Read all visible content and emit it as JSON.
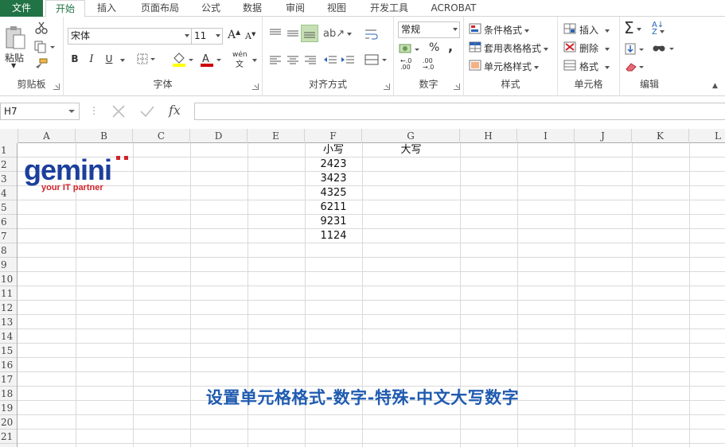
{
  "tabs": [
    "文件",
    "开始",
    "插入",
    "页面布局",
    "公式",
    "数据",
    "审阅",
    "视图",
    "开发工具",
    "ACROBAT"
  ],
  "ribbon": {
    "clipboard": {
      "paste_label": "粘贴",
      "group_label": "剪贴板"
    },
    "font": {
      "font_name": "宋体",
      "font_size": "11",
      "bold": "B",
      "italic": "I",
      "underline": "U",
      "phonetic": "wén",
      "phonetic_char": "文",
      "group_label": "字体"
    },
    "alignment": {
      "group_label": "对齐方式"
    },
    "number": {
      "format": "常规",
      "percent": "%",
      "comma": ",",
      "group_label": "数字"
    },
    "styles": {
      "conditional": "条件格式",
      "table": "套用表格格式",
      "cell_styles": "单元格样式",
      "group_label": "样式"
    },
    "cells": {
      "insert": "插入",
      "delete": "删除",
      "format": "格式",
      "group_label": "单元格"
    },
    "editing": {
      "group_label": "编辑"
    }
  },
  "formula_bar": {
    "name_box": "H7",
    "fx": "fx",
    "value": ""
  },
  "columns": [
    "A",
    "B",
    "C",
    "D",
    "E",
    "F",
    "G",
    "H",
    "I",
    "J",
    "K",
    "L"
  ],
  "rows": [
    "1",
    "2",
    "3",
    "4",
    "5",
    "6",
    "7",
    "8",
    "9",
    "10",
    "11",
    "12",
    "13",
    "14",
    "15",
    "16",
    "17",
    "18",
    "19",
    "20",
    "21"
  ],
  "cells": {
    "F1": "小写",
    "G1": "大写",
    "F2": "2423",
    "F3": "3423",
    "F4": "4325",
    "F5": "6211",
    "F6": "9231",
    "F7": "1124"
  },
  "logo": {
    "text": "gemini",
    "tagline": "your IT partner"
  },
  "caption": "设置单元格格式-数字-特殊-中文大写数字",
  "colors": {
    "accent": "#217346",
    "logo_blue": "#1b3f9c",
    "logo_red": "#d0232a",
    "caption": "#1f5bb0"
  }
}
